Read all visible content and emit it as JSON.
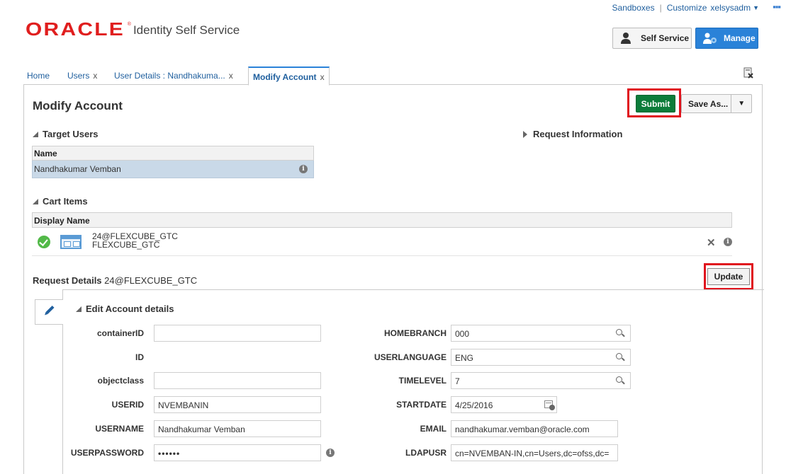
{
  "header": {
    "logo_text": "ORACLE",
    "logo_registered": "®",
    "app_title": "Identity Self Service",
    "top_links": {
      "sandboxes": "Sandboxes",
      "customize": "Customize",
      "user": "xelsysadm"
    },
    "self_service_label": "Self Service",
    "manage_label": "Manage"
  },
  "tabs": [
    {
      "label": "Home"
    },
    {
      "label": "Users"
    },
    {
      "label": "User Details : Nandhakuma..."
    },
    {
      "label": "Modify Account"
    }
  ],
  "page": {
    "title": "Modify Account",
    "submit_label": "Submit",
    "save_as_label": "Save As..."
  },
  "target_users": {
    "section_label": "Target Users",
    "column": "Name",
    "rows": [
      {
        "name": "Nandhakumar Vemban"
      }
    ]
  },
  "request_information": {
    "section_label": "Request Information"
  },
  "cart_items": {
    "section_label": "Cart Items",
    "column": "Display Name",
    "rows": [
      {
        "line1": "24@FLEXCUBE_GTC",
        "line2": "FLEXCUBE_GTC"
      }
    ]
  },
  "request_details": {
    "label": "Request Details",
    "item": "24@FLEXCUBE_GTC",
    "update_label": "Update"
  },
  "edit_account": {
    "section_label": "Edit Account details",
    "left_fields": [
      {
        "label": "containerID",
        "value": ""
      },
      {
        "label": "ID",
        "value": ""
      },
      {
        "label": "objectclass",
        "value": ""
      },
      {
        "label": "USERID",
        "value": "NVEMBANIN"
      },
      {
        "label": "USERNAME",
        "value": "Nandhakumar Vemban"
      },
      {
        "label": "USERPASSWORD",
        "value": "••••••"
      }
    ],
    "right_fields": [
      {
        "label": "HOMEBRANCH",
        "value": "000"
      },
      {
        "label": "USERLANGUAGE",
        "value": "ENG"
      },
      {
        "label": "TIMELEVEL",
        "value": "7"
      },
      {
        "label": "STARTDATE",
        "value": "4/25/2016"
      },
      {
        "label": "EMAIL",
        "value": "nandhakumar.vemban@oracle.com"
      },
      {
        "label": "LDAPUSR",
        "value": "cn=NVEMBAN-IN,cn=Users,dc=ofss,dc="
      }
    ]
  },
  "colors": {
    "oracle_red": "#e01e1e",
    "submit_green": "#0c7c3a",
    "manage_blue": "#2a82d8",
    "highlight_red": "#e0141e",
    "selected_row": "#c9d9e8"
  },
  "icons": [
    "more-icon",
    "self-service-icon",
    "manage-icon",
    "detach-icon",
    "info-icon",
    "check-icon",
    "application-icon",
    "remove-icon",
    "edit-pencil-icon",
    "search-icon",
    "calendar-icon"
  ]
}
